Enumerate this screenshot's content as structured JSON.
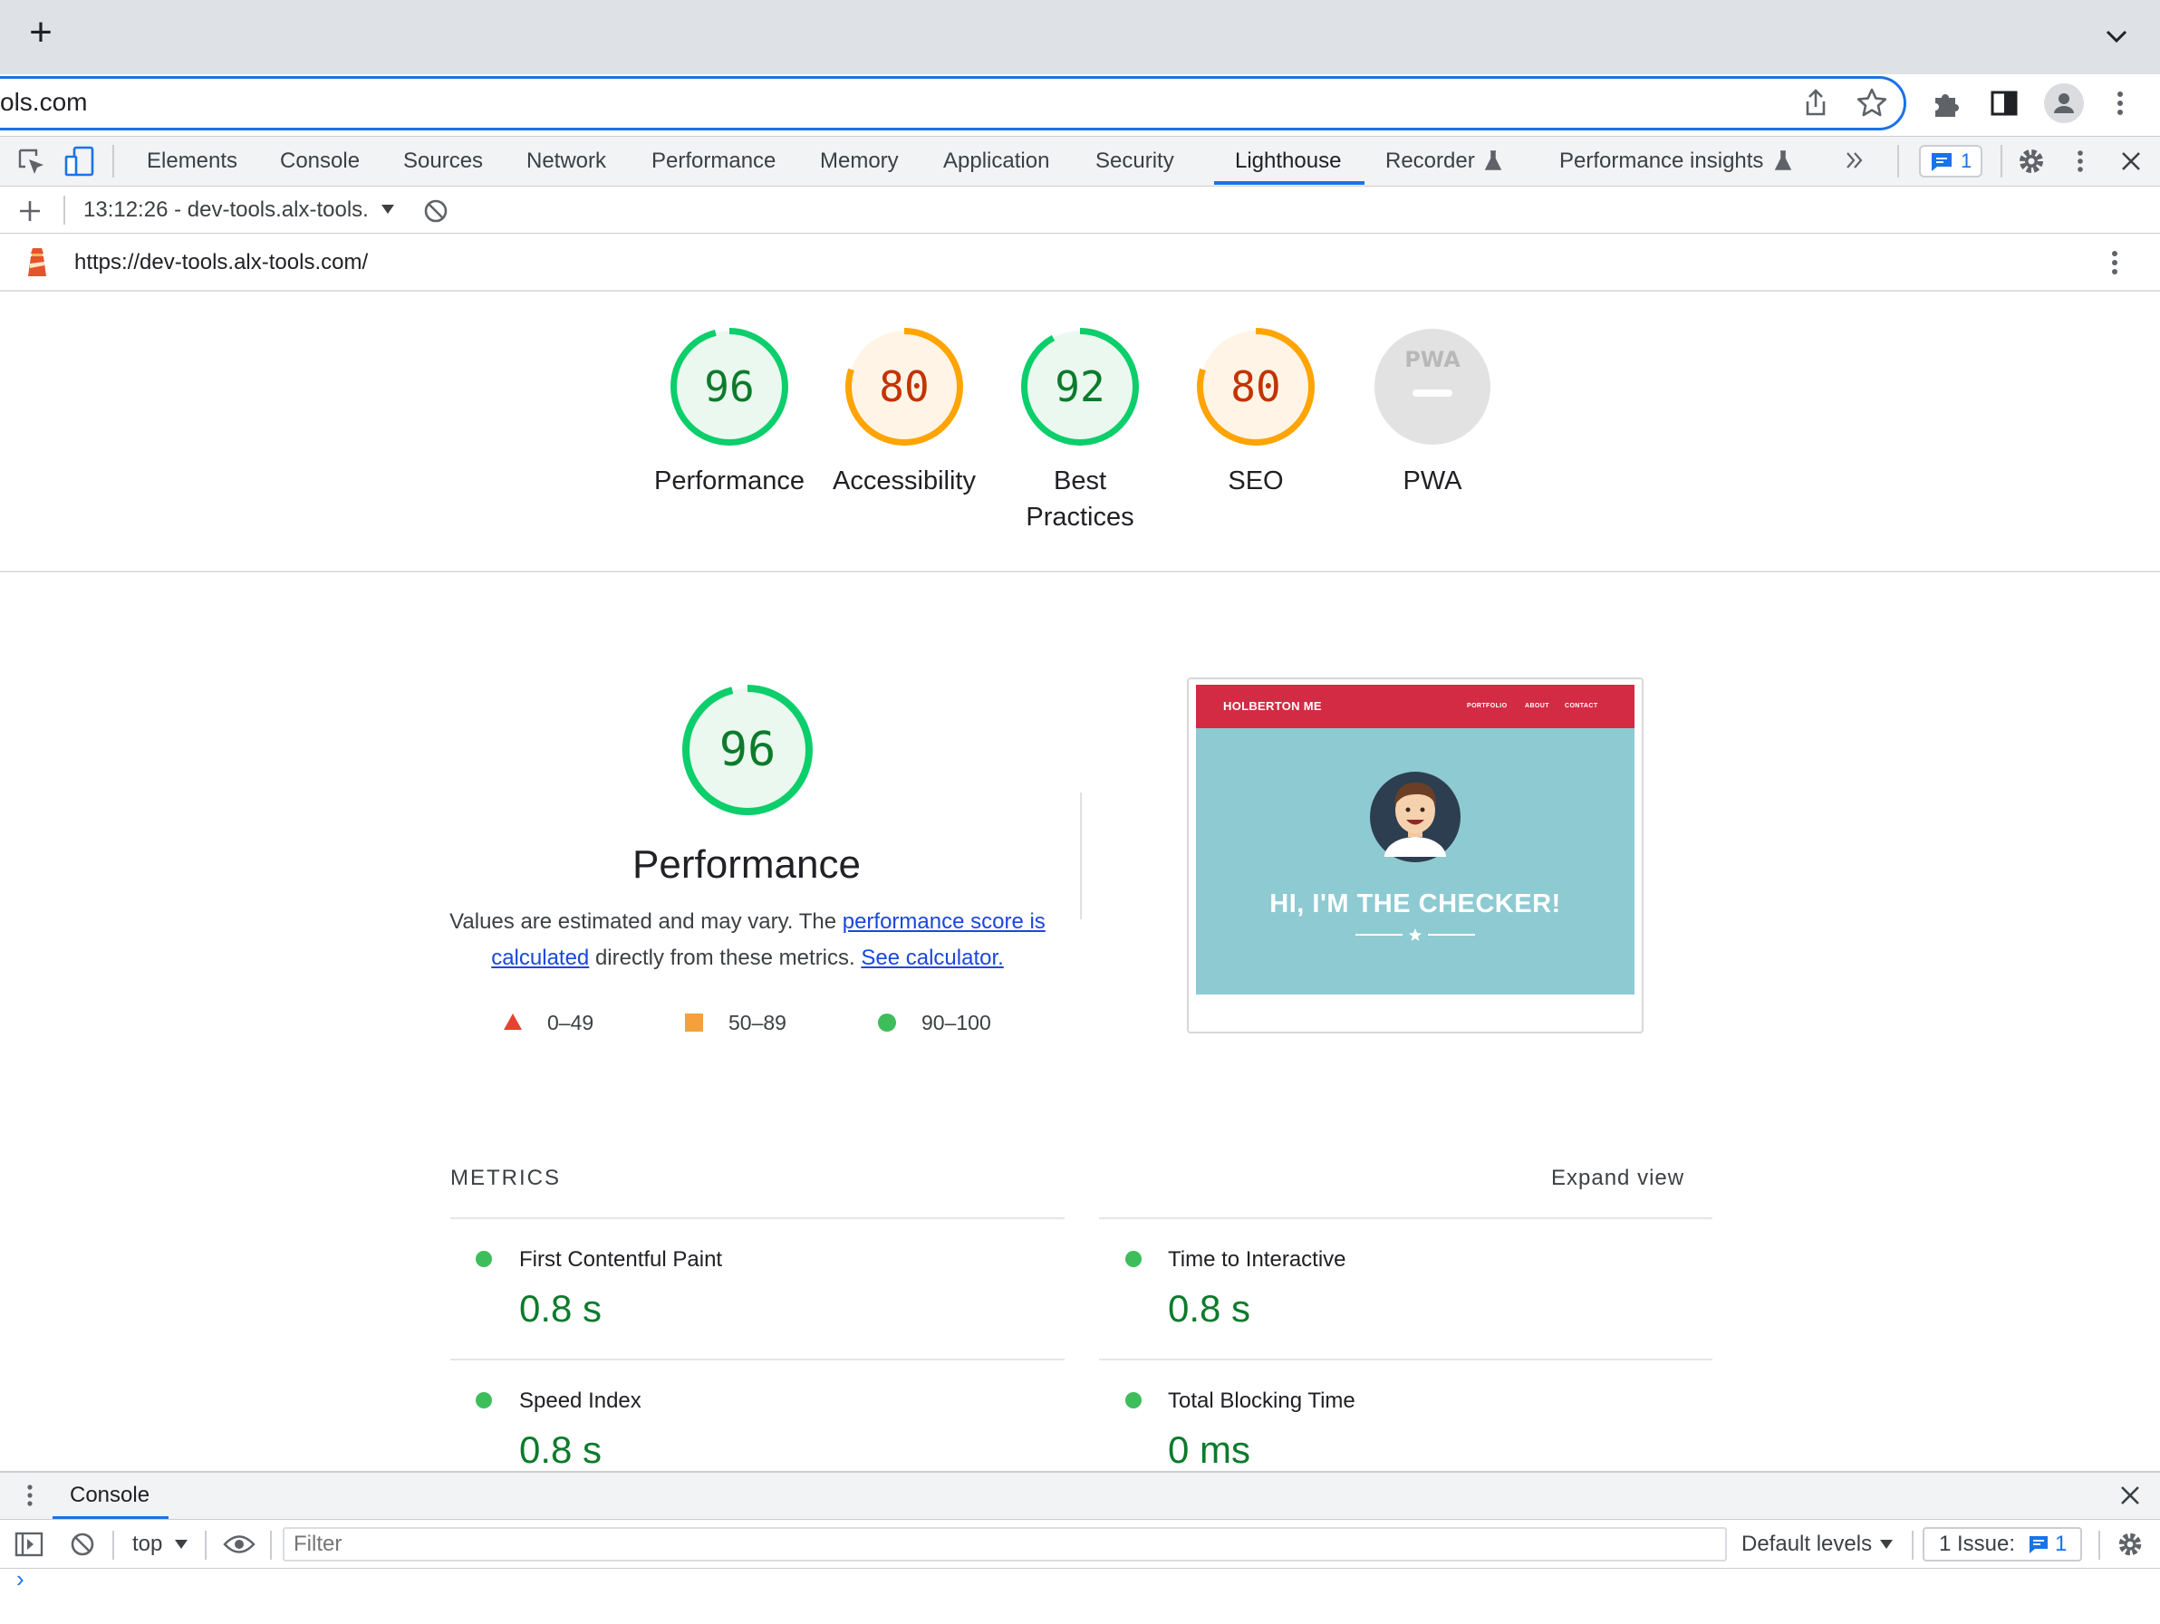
{
  "browser": {
    "new_tab_icon": "+",
    "address": "ols.com"
  },
  "devtools": {
    "tabs": [
      "Elements",
      "Console",
      "Sources",
      "Network",
      "Performance",
      "Memory",
      "Application",
      "Security",
      "Lighthouse",
      "Recorder",
      "Performance insights"
    ],
    "active_tab": "Lighthouse",
    "issues_badge": "1"
  },
  "lighthouse": {
    "report_select": "13:12:26 - dev-tools.alx-tools.",
    "url": "https://dev-tools.alx-tools.com/",
    "gauges": [
      {
        "score": "96",
        "label": "Performance",
        "value": 96,
        "color": "#0cce6b"
      },
      {
        "score": "80",
        "label": "Accessibility",
        "value": 80,
        "color": "#ffa400"
      },
      {
        "score": "92",
        "label": "Best Practices",
        "value": 92,
        "color": "#0cce6b"
      },
      {
        "score": "80",
        "label": "SEO",
        "value": 80,
        "color": "#ffa400"
      },
      {
        "score": "",
        "label": "PWA",
        "badge": "PWA",
        "color": "#dadada"
      }
    ],
    "performance": {
      "score": "96",
      "value": 96,
      "title": "Performance",
      "desc_prefix": "Values are estimated and may vary. The ",
      "desc_link1": "performance score is calculated",
      "desc_middle": " directly from these metrics. ",
      "desc_link2": "See calculator.",
      "legend": [
        {
          "range": "0–49",
          "shape": "triangle",
          "color": "#e8412f"
        },
        {
          "range": "50–89",
          "shape": "square",
          "color": "#f5a03a"
        },
        {
          "range": "90–100",
          "shape": "circle",
          "color": "#3ebd5b"
        }
      ]
    },
    "screenshot": {
      "brand": "HOLBERTON ME",
      "nav": [
        "PORTFOLIO",
        "ABOUT",
        "CONTACT"
      ],
      "headline": "HI, I'M THE CHECKER!"
    },
    "metrics": {
      "title": "METRICS",
      "expand": "Expand view",
      "items": [
        {
          "label": "First Contentful Paint",
          "value": "0.8 s"
        },
        {
          "label": "Time to Interactive",
          "value": "0.8 s"
        },
        {
          "label": "Speed Index",
          "value": "0.8 s"
        },
        {
          "label": "Total Blocking Time",
          "value": "0 ms"
        }
      ]
    }
  },
  "drawer": {
    "tab": "Console",
    "context": "top",
    "filter_placeholder": "Filter",
    "levels": "Default levels",
    "issues_label": "1 Issue:",
    "issues_count": "1",
    "prompt": "›"
  },
  "colors": {
    "accent": "#1a73e8",
    "pass": "#0c7b2b",
    "average": "#c33300"
  }
}
